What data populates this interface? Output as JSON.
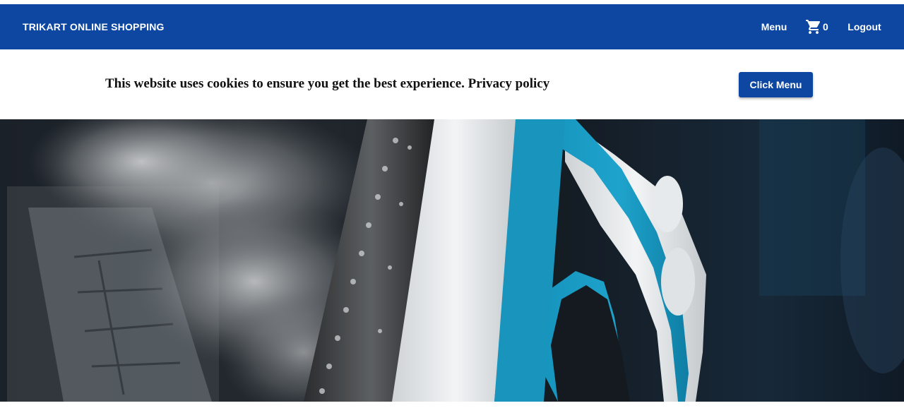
{
  "header": {
    "brand": "TRIKART ONLINE SHOPPING",
    "menu_label": "Menu",
    "cart_count": "0",
    "logout_label": "Logout"
  },
  "cookie": {
    "message": "This website uses cookies to ensure you get the best experience. Privacy policy",
    "button_label": "Click Menu"
  },
  "hero": {
    "image": "steam-iron-photo"
  },
  "colors": {
    "primary": "#0d47a1",
    "iron_blue": "#1a9cc4"
  }
}
